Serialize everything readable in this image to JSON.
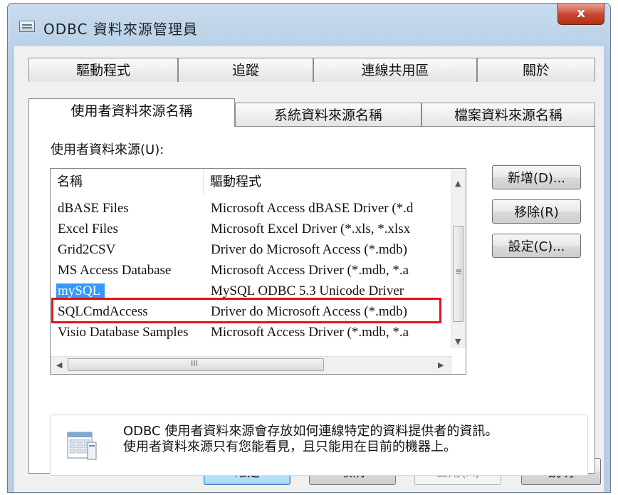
{
  "window": {
    "title": "ODBC 資料來源管理員",
    "close_glyph": "x"
  },
  "tabs_back": [
    "驅動程式",
    "追蹤",
    "連線共用區",
    "關於"
  ],
  "tabs_front": [
    "使用者資料來源名稱",
    "系統資料來源名稱",
    "檔案資料來源名稱"
  ],
  "active_tab": "使用者資料來源名稱",
  "panel": {
    "list_label": "使用者資料來源(U):",
    "columns": [
      "名稱",
      "驅動程式"
    ],
    "rows": [
      {
        "name": "dBASE Files",
        "driver": "Microsoft Access dBASE Driver (*.d"
      },
      {
        "name": "Excel Files",
        "driver": "Microsoft Excel Driver (*.xls, *.xlsx"
      },
      {
        "name": "Grid2CSV",
        "driver": "Driver do Microsoft Access (*.mdb)"
      },
      {
        "name": "MS Access Database",
        "driver": "Microsoft Access Driver (*.mdb, *.a"
      },
      {
        "name": "mySQL",
        "driver": "MySQL ODBC 5.3 Unicode Driver"
      },
      {
        "name": "SQLCmdAccess",
        "driver": "Driver do Microsoft Access (*.mdb)"
      },
      {
        "name": "Visio Database Samples",
        "driver": "Microsoft Access Driver (*.mdb, *.a"
      }
    ],
    "selected_row": "mySQL",
    "buttons": {
      "add": "新增(D)...",
      "remove": "移除(R)",
      "configure": "設定(C)..."
    },
    "info_line1": "ODBC 使用者資料來源會存放如何連線特定的資料提供者的資訊。",
    "info_line2": "使用者資料來源只有您能看見，且只能用在目前的機器上。"
  },
  "footer": {
    "ok": "確定",
    "cancel": "取消",
    "apply": "套用(A)",
    "help": "說明"
  },
  "icons": {
    "vscroll_mid": "≡",
    "hscroll_mid": "III"
  }
}
